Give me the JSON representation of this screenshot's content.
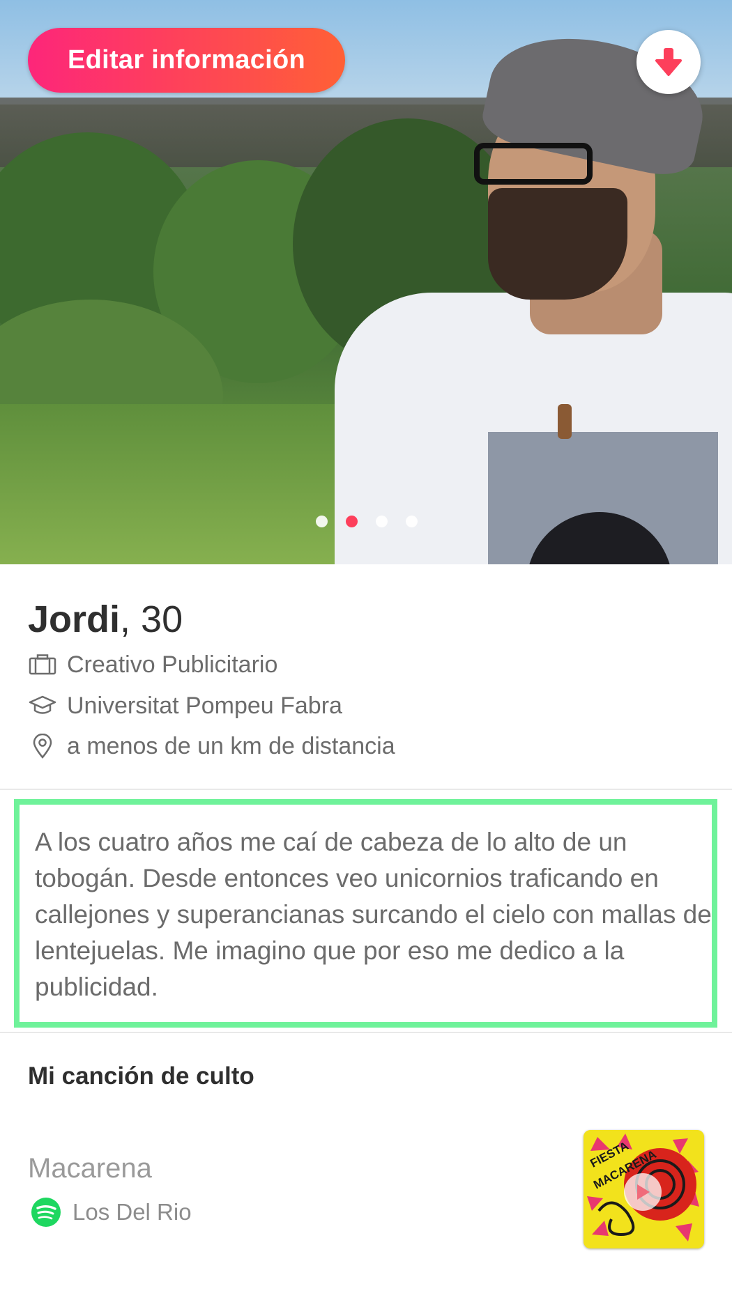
{
  "header": {
    "edit_label": "Editar información",
    "photo_count": 4,
    "active_photo_index": 1
  },
  "profile": {
    "name": "Jordi",
    "age_text": ", 30",
    "job": "Creativo Publicitario",
    "school": "Universitat Pompeu Fabra",
    "distance": "a menos de un km de distancia",
    "bio": "A los cuatro años me caí de cabeza de lo alto de un tobogán. Desde entonces veo unicornios traficando en callejones y superancianas surcando el cielo con mallas de lentejuelas. Me imagino que por eso me dedico a la publicidad."
  },
  "anthem": {
    "section_title": "Mi canción de culto",
    "song": "Macarena",
    "artist": "Los Del Rio",
    "album_text": "FIESTA MACARENA"
  },
  "colors": {
    "brand_gradient_start": "#fd267a",
    "brand_gradient_end": "#ff6036",
    "highlight_border": "#6ff29a",
    "spotify_green": "#1ed760"
  }
}
